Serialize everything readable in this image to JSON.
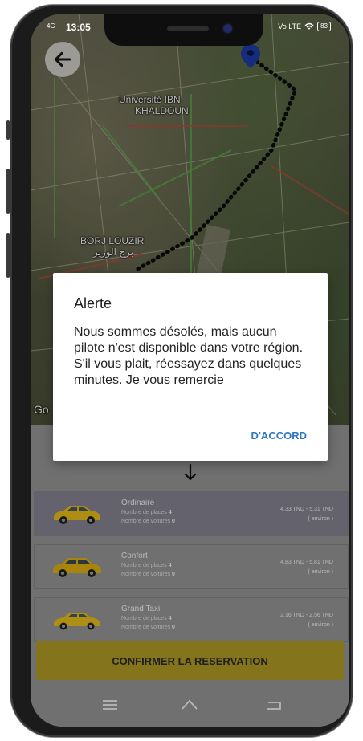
{
  "status_bar": {
    "network": "4G",
    "time": "13:05",
    "battery": "83",
    "volte": "Vo LTE"
  },
  "map": {
    "labels": [
      "Université IBN",
      "KHALDOUN",
      "BORJ LOUZIR",
      "برج الوزير"
    ],
    "watermark": "Go"
  },
  "dialog": {
    "title": "Alerte",
    "message": "Nous sommes désolés, mais aucun pilote n'est disponible dans votre région. S'il vous plait, réessayez dans quelques minutes. Je vous remercie",
    "ok_label": "D'ACCORD"
  },
  "vehicles": [
    {
      "name": "Ordinaire",
      "places_label": "Nombre de places",
      "places": "4",
      "cars_label": "Nombre de voitures",
      "cars": "0",
      "price": "4.33 TND - 5.31 TND",
      "note": "( environ )"
    },
    {
      "name": "Confort",
      "places_label": "Nombre de places",
      "places": "4",
      "cars_label": "Nombre de voitures",
      "cars": "0",
      "price": "4.83 TND - 5.81 TND",
      "note": "( environ )"
    },
    {
      "name": "Grand Taxi",
      "places_label": "Nombre de places",
      "places": "4",
      "cars_label": "Nombre de voitures",
      "cars": "0",
      "price": "2.16 TND - 2.56 TND",
      "note": "( environ )"
    }
  ],
  "confirm_label": "CONFIRMER LA RESERVATION",
  "colors": {
    "accent": "#b8a327",
    "dialog_button": "#2f77c2",
    "selected_card": "#8a8898"
  },
  "icons": [
    "back-arrow-icon",
    "location-pin-icon",
    "arrow-down-icon",
    "taxi-car-icon",
    "menu-icon",
    "home-icon",
    "back-icon"
  ]
}
